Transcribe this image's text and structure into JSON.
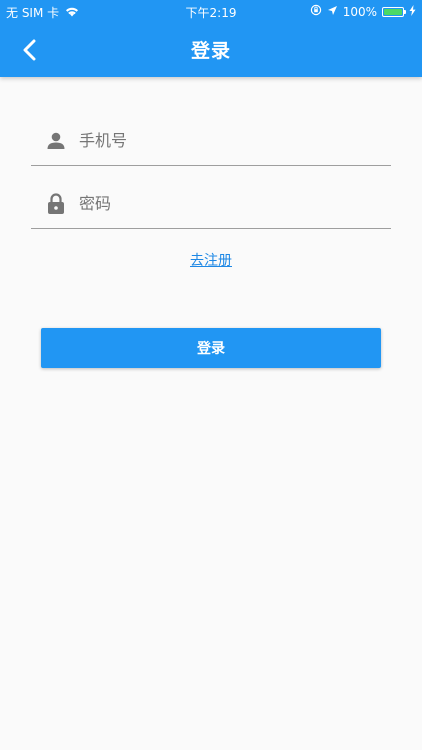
{
  "status_bar": {
    "carrier": "无 SIM 卡",
    "time": "下午2:19",
    "battery": "100%"
  },
  "app_bar": {
    "title": "登录",
    "background": "#2196F3"
  },
  "form": {
    "phone_placeholder": "手机号",
    "password_placeholder": "密码",
    "phone_icon": "person-icon",
    "password_icon": "lock-icon"
  },
  "register_link": "去注册",
  "login_button": "登录"
}
